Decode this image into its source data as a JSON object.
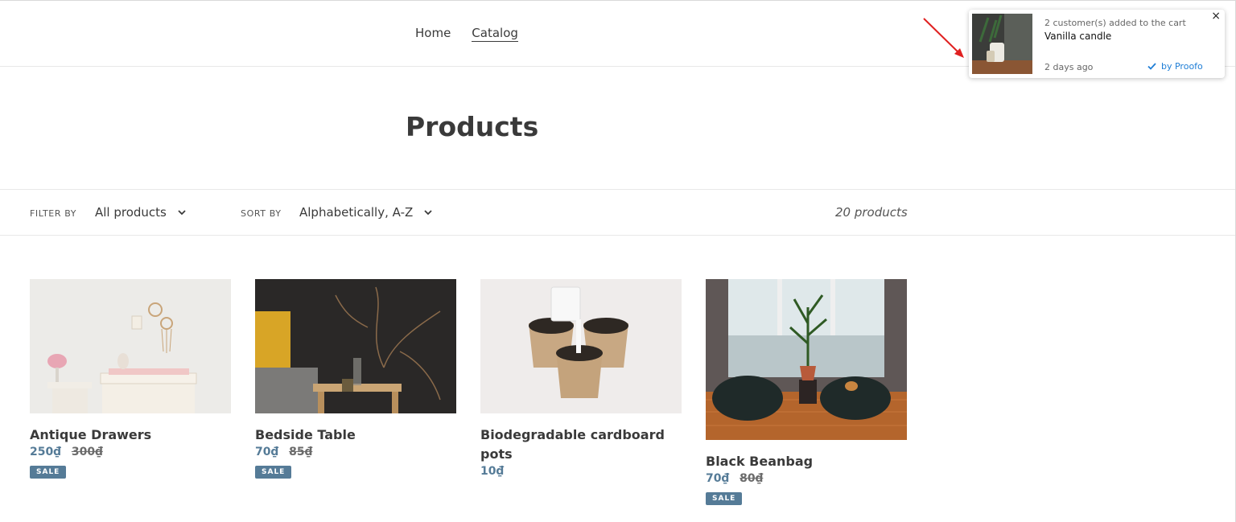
{
  "nav": {
    "home": "Home",
    "catalog": "Catalog"
  },
  "page": {
    "title": "Products"
  },
  "filters": {
    "filter_label": "FILTER BY",
    "filter_value": "All products",
    "sort_label": "SORT BY",
    "sort_value": "Alphabetically, A-Z",
    "count": "20 products"
  },
  "products": [
    {
      "title": "Antique Drawers",
      "price": "250₫",
      "compare": "300₫",
      "badge": "SALE"
    },
    {
      "title": "Bedside Table",
      "price": "70₫",
      "compare": "85₫",
      "badge": "SALE"
    },
    {
      "title": "Biodegradable cardboard pots",
      "price": "10₫"
    },
    {
      "title": "Black Beanbag",
      "price": "70₫",
      "compare": "80₫",
      "badge": "SALE"
    }
  ],
  "notification": {
    "line1": "2 customer(s) added to the cart",
    "product": "Vanilla candle",
    "time": "2 days ago",
    "brand": "by Proofo",
    "close": "×"
  },
  "colors": {
    "accent": "#557b97",
    "proofo": "#1f7ed6",
    "arrow": "#e02020"
  }
}
